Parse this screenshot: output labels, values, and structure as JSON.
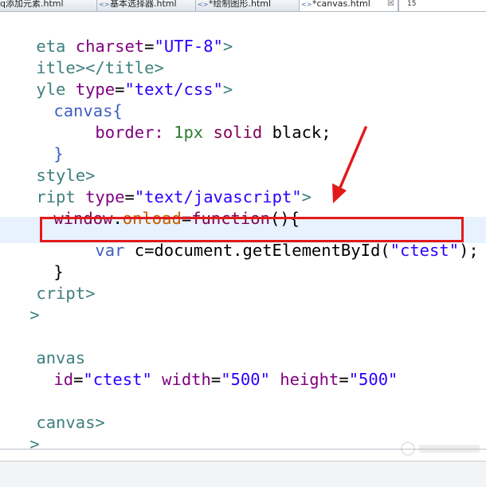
{
  "tabs": [
    {
      "label": "q添加元素.html",
      "active": false
    },
    {
      "label": "基本选择器.html",
      "active": false
    },
    {
      "label": "*绘制图形.html",
      "active": false
    },
    {
      "label": "*canvas.html",
      "active": true
    }
  ],
  "tab_close": "☒",
  "tab_extra": "15",
  "colors": {
    "highlight_box": "#e21a1a",
    "arrow": "#e21a1a",
    "tag": "#3f7f7f",
    "attribute": "#7f007f",
    "string": "#2a00ff"
  },
  "code": {
    "l1_tag": "eta",
    "l1_attr": "charset",
    "l1_eq": "=",
    "l1_val": "\"UTF-8\"",
    "l1_close": ">",
    "l2_tag": "itle></title>",
    "l3_tag": "yle",
    "l3_attr": "type",
    "l3_eq": "=",
    "l3_val": "\"text/css\"",
    "l3_close": ">",
    "l4_selector": "canvas{",
    "l5_prop": "border:",
    "l5_num": "1px",
    "l5_val": "solid",
    "l5_val2": "black;",
    "l6_brace": "}",
    "l7_tag": "style>",
    "l8_tag": "ript",
    "l8_attr": "type",
    "l8_eq": "=",
    "l8_val": "\"text/javascript\"",
    "l8_close": ">",
    "l9_obj": "window",
    "l9_dot": ".",
    "l9_evt": "onload",
    "l9_eq": "=",
    "l9_fn": "function",
    "l9_paren": "(){",
    "l10_kw": "var",
    "l10_text": " c=document.getElementById(",
    "l10_str": "\"ctest\"",
    "l10_end": ");",
    "l11_brace": "}",
    "l12_tag": "cript>",
    "l13_tag": ">",
    "l15_tag": "anvas",
    "l16_attr1": "id",
    "l16_eq": "=",
    "l16_val1": "\"ctest\"",
    "l16_attr2": "width",
    "l16_val2": "\"500\"",
    "l16_attr3": "height",
    "l16_val3": "\"500\"",
    "l18_tag": "canvas>",
    "l19_tag": ">"
  }
}
